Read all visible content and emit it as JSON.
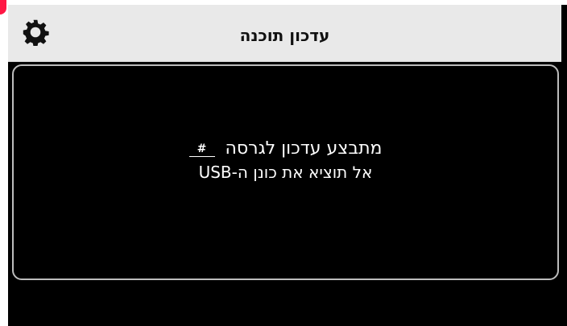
{
  "header": {
    "title": "עדכון תוכנה",
    "settings_icon": "gear-icon",
    "background_color": "#e9e9e9"
  },
  "dialog": {
    "line1_text": "מתבצע עדכון לגרסה",
    "version": "#",
    "line2_text": "אל תוציא את כונן ה-USB",
    "border_color": "#bdbdbd",
    "text_color": "#ffffff"
  },
  "colors": {
    "screen_background": "#000000",
    "accent_mark": "#ff1744"
  }
}
